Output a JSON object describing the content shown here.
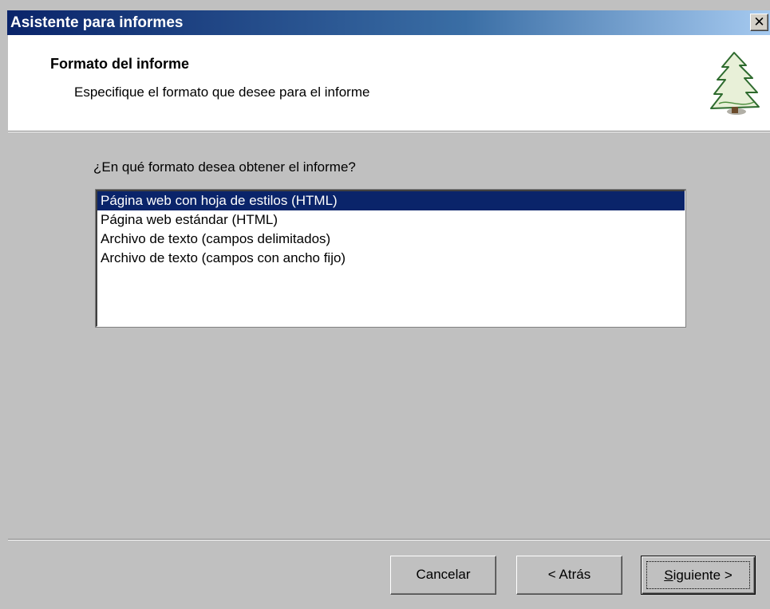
{
  "window": {
    "title": "Asistente para informes",
    "close_glyph": "✕"
  },
  "header": {
    "title": "Formato del informe",
    "subtitle": "Especifique el formato que desee para el informe",
    "icon": "tree-icon"
  },
  "main": {
    "question": "¿En qué formato desea obtener el informe?",
    "formats": [
      {
        "label": "Página web con hoja de estilos (HTML)",
        "selected": true
      },
      {
        "label": "Página web estándar (HTML)",
        "selected": false
      },
      {
        "label": "Archivo de texto (campos delimitados)",
        "selected": false
      },
      {
        "label": "Archivo de texto (campos con ancho fijo)",
        "selected": false
      }
    ]
  },
  "buttons": {
    "cancel": "Cancelar",
    "back": "< Atrás",
    "next_accel": "S",
    "next_rest": "iguiente >"
  },
  "colors": {
    "titlebar": "#0a246a",
    "selection": "#0a246a",
    "face": "#c0c0c0"
  }
}
